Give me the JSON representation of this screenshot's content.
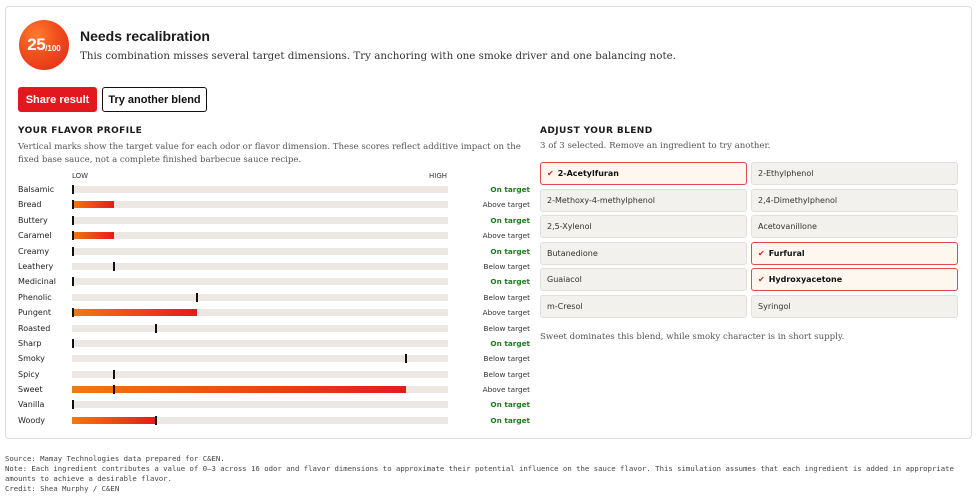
{
  "result": {
    "score": "25",
    "score_max": "/100",
    "title": "Needs recalibration",
    "message": "This combination misses several target dimensions. Try anchoring with one smoke driver and one balancing note."
  },
  "actions": {
    "share_label": "Share result",
    "retry_label": "Try another blend"
  },
  "profile": {
    "title": "YOUR FLAVOR PROFILE",
    "note": "Vertical marks show the target value for each odor or flavor dimension. These scores reflect additive impact on the fixed base sauce, not a complete finished barbecue sauce recipe.",
    "scale_low": "LOW",
    "scale_high": "HIGH",
    "colors": {
      "bar_start": "#f07a10",
      "bar_end": "#e61b1b",
      "on_target": "#1f7a1f"
    },
    "rows": [
      {
        "label": "Balsamic",
        "value": 0,
        "target": 0,
        "status": "On target"
      },
      {
        "label": "Bread",
        "value": 1,
        "target": 0,
        "status": "Above target"
      },
      {
        "label": "Buttery",
        "value": 0,
        "target": 0,
        "status": "On target"
      },
      {
        "label": "Caramel",
        "value": 1,
        "target": 0,
        "status": "Above target"
      },
      {
        "label": "Creamy",
        "value": 0,
        "target": 0,
        "status": "On target"
      },
      {
        "label": "Leathery",
        "value": 0,
        "target": 1,
        "status": "Below target"
      },
      {
        "label": "Medicinal",
        "value": 0,
        "target": 0,
        "status": "On target"
      },
      {
        "label": "Phenolic",
        "value": 0,
        "target": 3,
        "status": "Below target"
      },
      {
        "label": "Pungent",
        "value": 3,
        "target": 0,
        "status": "Above target"
      },
      {
        "label": "Roasted",
        "value": 0,
        "target": 2,
        "status": "Below target"
      },
      {
        "label": "Sharp",
        "value": 0,
        "target": 0,
        "status": "On target"
      },
      {
        "label": "Smoky",
        "value": 0,
        "target": 8,
        "status": "Below target"
      },
      {
        "label": "Spicy",
        "value": 0,
        "target": 1,
        "status": "Below target"
      },
      {
        "label": "Sweet",
        "value": 8,
        "target": 1,
        "status": "Above target"
      },
      {
        "label": "Vanilla",
        "value": 0,
        "target": 0,
        "status": "On target"
      },
      {
        "label": "Woody",
        "value": 2,
        "target": 2,
        "status": "On target"
      }
    ],
    "scale_max": 9
  },
  "adjust": {
    "title": "ADJUST YOUR BLEND",
    "note": "3 of 3 selected. Remove an ingredient to try another.",
    "check_icon": "✔",
    "ingredients": [
      {
        "name": "2-Acetylfuran",
        "selected": true
      },
      {
        "name": "2-Ethylphenol",
        "selected": false
      },
      {
        "name": "2-Methoxy-4-methylphenol",
        "selected": false
      },
      {
        "name": "2,4-Dimethylphenol",
        "selected": false
      },
      {
        "name": "2,5-Xylenol",
        "selected": false
      },
      {
        "name": "Acetovanillone",
        "selected": false
      },
      {
        "name": "Butanedione",
        "selected": false
      },
      {
        "name": "Furfural",
        "selected": true
      },
      {
        "name": "Guaiacol",
        "selected": false
      },
      {
        "name": "Hydroxyacetone",
        "selected": true
      },
      {
        "name": "m-Cresol",
        "selected": false
      },
      {
        "name": "Syringol",
        "selected": false
      }
    ],
    "summary": "Sweet dominates this blend, while smoky character is in short supply."
  },
  "footnotes": {
    "source": "Source: Mamay Technologies data prepared for C&EN.",
    "note": "Note: Each ingredient contributes a value of 0–3 across 16 odor and flavor dimensions to approximate their potential influence on the sauce flavor. This simulation assumes that each ingredient is added in appropriate amounts to achieve a desirable flavor.",
    "credit": "Credit: Shea Murphy / C&EN"
  }
}
